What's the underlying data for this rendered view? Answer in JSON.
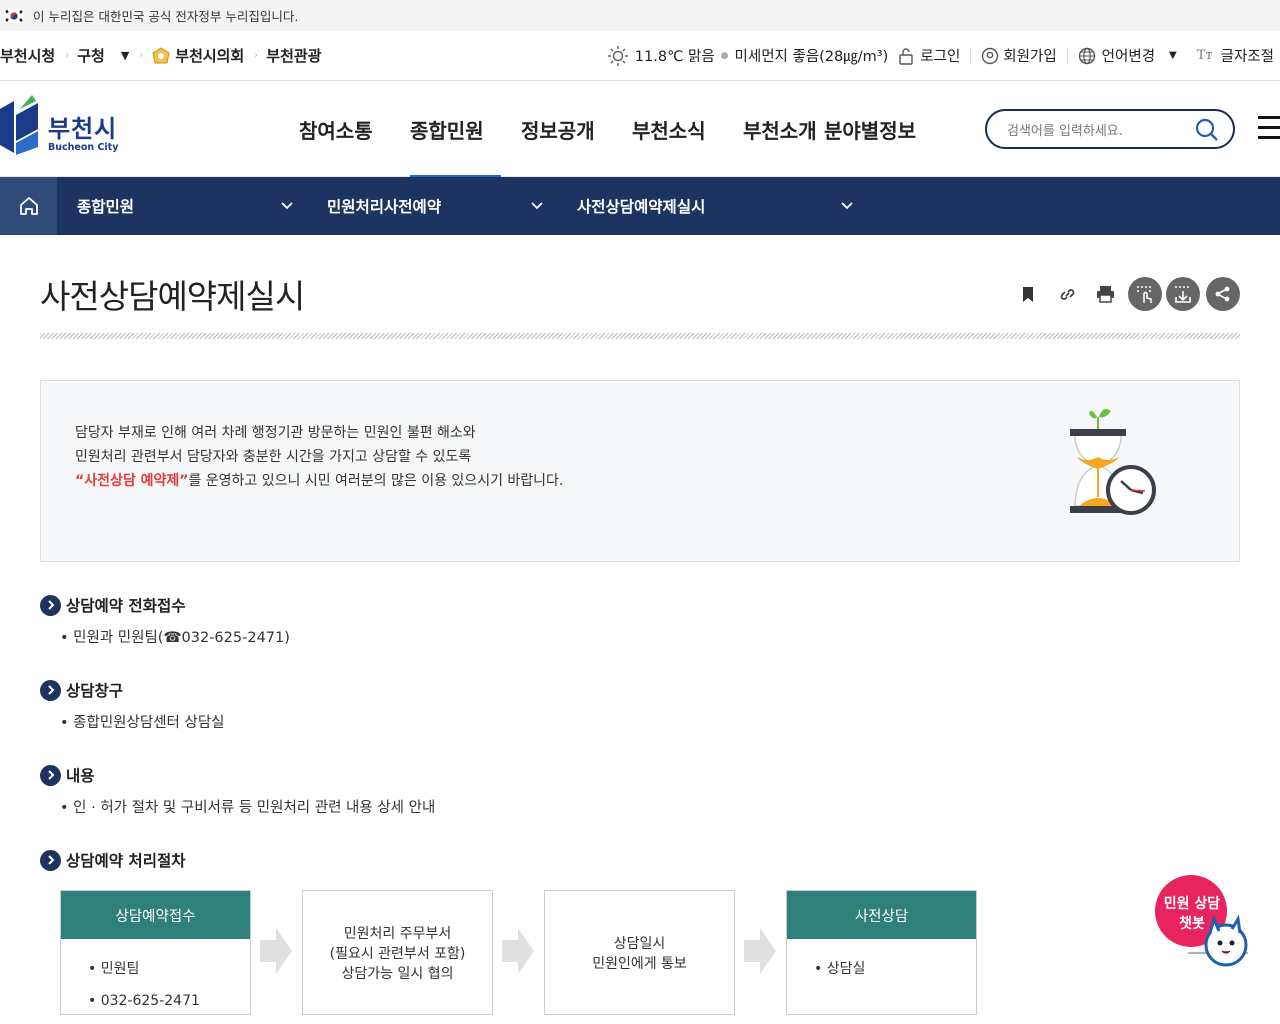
{
  "gov_banner": {
    "text": "이 누리집은 대한민국 공식 전자정부 누리집입니다."
  },
  "util": {
    "links": [
      "부천시청",
      "구청",
      "부천시의회",
      "부천관광"
    ],
    "weather": "11.8℃ 맑음",
    "dust": "미세먼지 좋음(28㎍/m³)",
    "login": "로그인",
    "join": "회원가입",
    "language": "언어변경",
    "font_size": "글자조절"
  },
  "logo": {
    "korean": "부천시",
    "english": "Bucheon City"
  },
  "gnb": {
    "items": [
      "참여소통",
      "종합민원",
      "정보공개",
      "부천소식",
      "부천소개",
      "분야별정보"
    ],
    "active_index": 1
  },
  "search": {
    "placeholder": "검색어를 입력하세요."
  },
  "lnb": {
    "depth1": "종합민원",
    "depth2": "민원처리사전예약",
    "depth3": "사전상담예약제실시"
  },
  "page": {
    "title": "사전상담예약제실시"
  },
  "intro": {
    "line1": "담당자 부재로 인해 여러 차례 행정기관 방문하는 민원인 불편 해소와",
    "line2": "민원처리 관련부서 담당자와 충분한 시간을 가지고 상담할 수 있도록",
    "line3_highlight": "“사전상담 예약제”",
    "line3_rest": "를 운영하고 있으니 시민 여러분의 많은 이용 있으시기 바랍니다."
  },
  "sections": [
    {
      "heading": "상담예약 전화접수",
      "item": "• 민원과 민원팀(☎032-625-2471)"
    },
    {
      "heading": "상담창구",
      "item": "• 종합민원상담센터 상담실"
    },
    {
      "heading": "내용",
      "item": "• 인 · 허가 절차 및 구비서류 등 민원처리 관련 내용 상세 안내"
    },
    {
      "heading": "상담예약 처리절차"
    }
  ],
  "process": {
    "step1": {
      "title": "상담예약접수",
      "items": [
        "• 민원팀",
        "• 032-625-2471"
      ]
    },
    "step2": {
      "lines": [
        "민원처리 주무부서",
        "(필요시 관련부서 포함)",
        "상담가능 일시 협의"
      ]
    },
    "step3": {
      "lines": [
        "상담일시",
        "민원인에게 통보"
      ]
    },
    "step4": {
      "title": "사전상담",
      "items": [
        "• 상담실"
      ]
    }
  },
  "chatbot": {
    "line1": "민원 상담",
    "line2": "챗봇"
  },
  "colors": {
    "navy": "#1d3460",
    "teal": "#2f7f7a",
    "accent_red": "#e23b3b",
    "active_underline": "#1e6bc0"
  }
}
